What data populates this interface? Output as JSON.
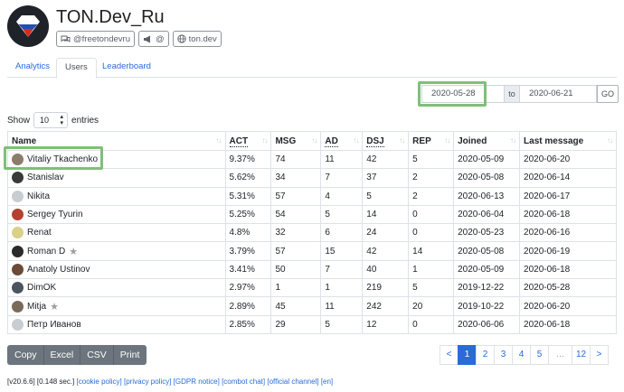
{
  "site": {
    "title": "TON.Dev_Ru",
    "badges": [
      {
        "icon": "comments-icon",
        "label": "@freetondevru"
      },
      {
        "icon": "megaphone-icon",
        "label": "@"
      },
      {
        "icon": "globe-icon",
        "label": "ton.dev"
      }
    ]
  },
  "tabs": [
    {
      "label": "Analytics",
      "active": false
    },
    {
      "label": "Users",
      "active": true
    },
    {
      "label": "Leaderboard",
      "active": false
    }
  ],
  "date_range": {
    "from": "2020-05-28",
    "separator": "to",
    "to": "2020-06-21",
    "go_label": "GO"
  },
  "show_entries": {
    "prefix": "Show",
    "value": "10",
    "suffix": "entries"
  },
  "table": {
    "headers": [
      "Name",
      "ACT",
      "MSG",
      "AD",
      "DSJ",
      "REP",
      "Joined",
      "Last message"
    ],
    "rows": [
      {
        "name": "Vitaliy Tkachenko",
        "act": "9.37%",
        "msg": "74",
        "ad": "11",
        "dsj": "42",
        "rep": "5",
        "joined": "2020-05-09",
        "last": "2020-06-20",
        "star": false,
        "avatar": "#8b7d6b"
      },
      {
        "name": "Stanislav",
        "act": "5.62%",
        "msg": "34",
        "ad": "7",
        "dsj": "37",
        "rep": "2",
        "joined": "2020-05-08",
        "last": "2020-06-14",
        "star": false,
        "avatar": "#3a3a3a"
      },
      {
        "name": "Nikita",
        "act": "5.31%",
        "msg": "57",
        "ad": "4",
        "dsj": "5",
        "rep": "2",
        "joined": "2020-06-13",
        "last": "2020-06-17",
        "star": false,
        "avatar": "#c8cdd2"
      },
      {
        "name": "Sergey Tyurin",
        "act": "5.25%",
        "msg": "54",
        "ad": "5",
        "dsj": "14",
        "rep": "0",
        "joined": "2020-06-04",
        "last": "2020-06-18",
        "star": false,
        "avatar": "#b5412f"
      },
      {
        "name": "Renat",
        "act": "4.8%",
        "msg": "32",
        "ad": "6",
        "dsj": "24",
        "rep": "0",
        "joined": "2020-05-23",
        "last": "2020-06-16",
        "star": false,
        "avatar": "#d9d08a"
      },
      {
        "name": "Roman D",
        "act": "3.79%",
        "msg": "57",
        "ad": "15",
        "dsj": "42",
        "rep": "14",
        "joined": "2020-05-08",
        "last": "2020-06-19",
        "star": true,
        "avatar": "#2b2b2b"
      },
      {
        "name": "Anatoly Ustinov",
        "act": "3.41%",
        "msg": "50",
        "ad": "7",
        "dsj": "40",
        "rep": "1",
        "joined": "2020-05-09",
        "last": "2020-06-18",
        "star": false,
        "avatar": "#6b4a3a"
      },
      {
        "name": "DimOK",
        "act": "2.97%",
        "msg": "1",
        "ad": "1",
        "dsj": "219",
        "rep": "5",
        "joined": "2019-12-22",
        "last": "2020-05-28",
        "star": false,
        "avatar": "#4a5560"
      },
      {
        "name": "Mitja",
        "act": "2.89%",
        "msg": "45",
        "ad": "11",
        "dsj": "242",
        "rep": "20",
        "joined": "2019-10-22",
        "last": "2020-06-20",
        "star": true,
        "avatar": "#7a6a5a"
      },
      {
        "name": "Петр Иванов",
        "act": "2.85%",
        "msg": "29",
        "ad": "5",
        "dsj": "12",
        "rep": "0",
        "joined": "2020-06-06",
        "last": "2020-06-18",
        "star": false,
        "avatar": "#c8cdd2"
      }
    ]
  },
  "export_buttons": [
    "Copy",
    "Excel",
    "CSV",
    "Print"
  ],
  "pagination": [
    "<",
    "1",
    "2",
    "3",
    "4",
    "5",
    "…",
    "12",
    ">"
  ],
  "pagination_active": "1",
  "footer": {
    "prefix": "[v20.6.6] [0.148 sec.]",
    "links": [
      "[cookie policy]",
      "[privacy policy]",
      "[GDPR notice]",
      "[combot chat]",
      "[official channel]",
      "[en]"
    ]
  },
  "colors": {
    "accent": "#2a6bd6",
    "highlight": "#7fbf7a",
    "button_gray": "#6c757d"
  }
}
